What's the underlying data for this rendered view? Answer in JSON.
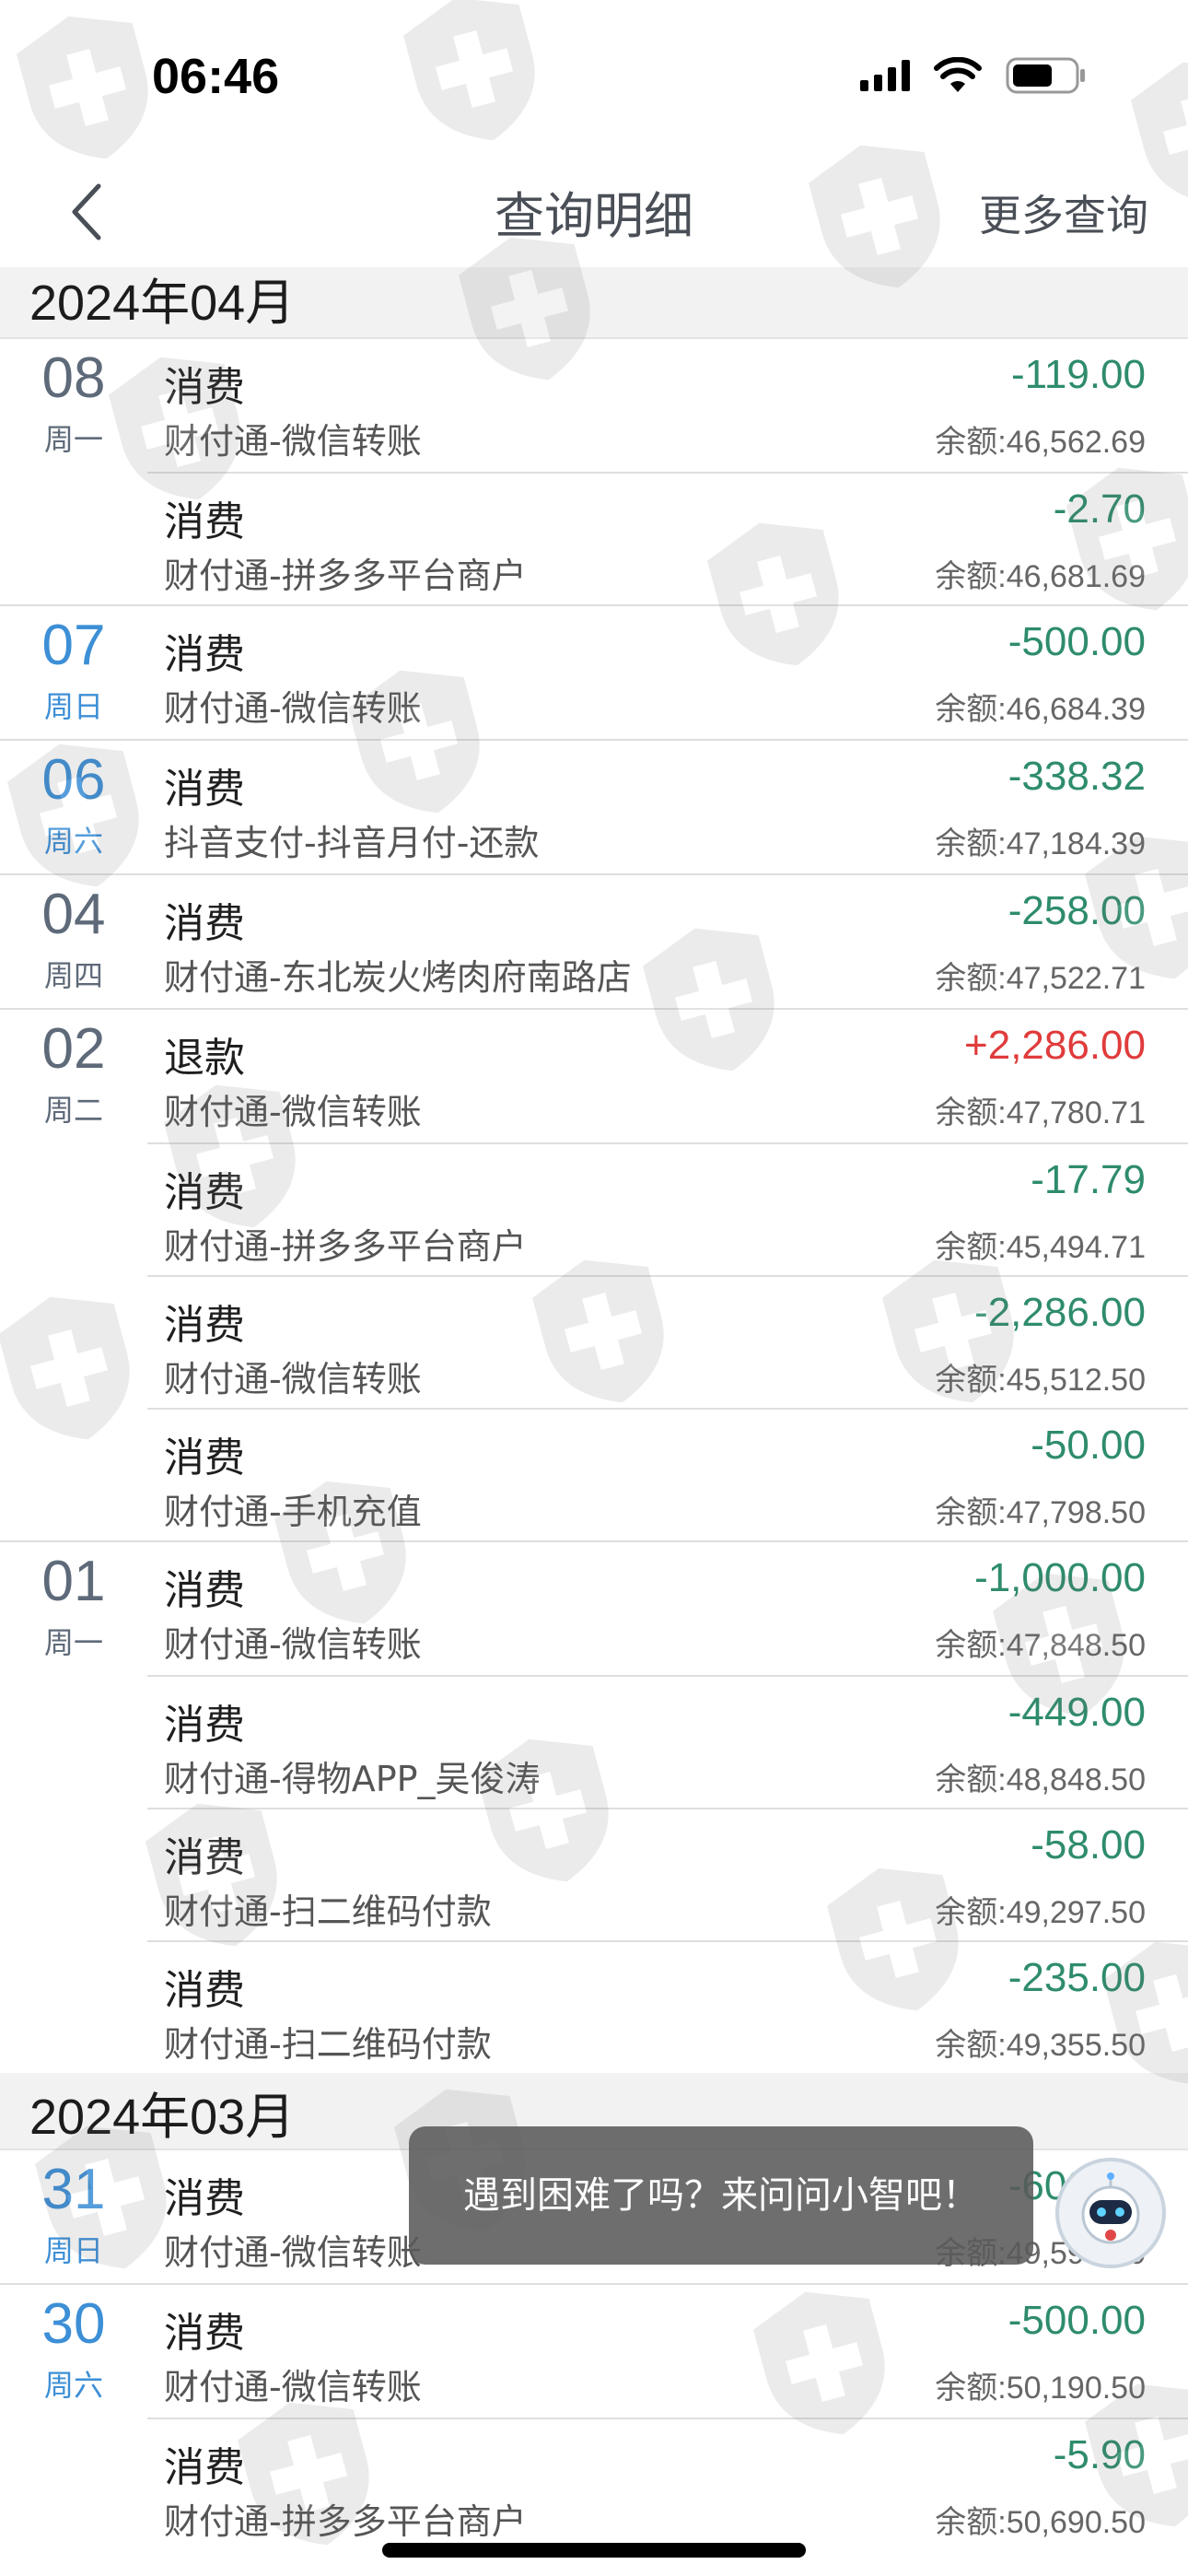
{
  "status_bar": {
    "time": "06:46"
  },
  "nav": {
    "title": "查询明细",
    "more": "更多查询"
  },
  "months": [
    {
      "label": "2024年04月",
      "days": [
        {
          "day": "08",
          "week": "周一",
          "color": "grey",
          "items": [
            {
              "type": "消费",
              "desc": "财付通-微信转账",
              "amount": "-119.00",
              "balance": "余额:46,562.69"
            },
            {
              "type": "消费",
              "desc": "财付通-拼多多平台商户",
              "amount": "-2.70",
              "balance": "余额:46,681.69"
            }
          ]
        },
        {
          "day": "07",
          "week": "周日",
          "color": "blue",
          "items": [
            {
              "type": "消费",
              "desc": "财付通-微信转账",
              "amount": "-500.00",
              "balance": "余额:46,684.39"
            }
          ]
        },
        {
          "day": "06",
          "week": "周六",
          "color": "blue",
          "items": [
            {
              "type": "消费",
              "desc": "抖音支付-抖音月付-还款",
              "amount": "-338.32",
              "balance": "余额:47,184.39"
            }
          ]
        },
        {
          "day": "04",
          "week": "周四",
          "color": "grey",
          "items": [
            {
              "type": "消费",
              "desc": "财付通-东北炭火烤肉府南路店",
              "amount": "-258.00",
              "balance": "余额:47,522.71"
            }
          ]
        },
        {
          "day": "02",
          "week": "周二",
          "color": "grey",
          "items": [
            {
              "type": "退款",
              "desc": "财付通-微信转账",
              "amount": "+2,286.00",
              "balance": "余额:47,780.71",
              "refund": true
            },
            {
              "type": "消费",
              "desc": "财付通-拼多多平台商户",
              "amount": "-17.79",
              "balance": "余额:45,494.71"
            },
            {
              "type": "消费",
              "desc": "财付通-微信转账",
              "amount": "-2,286.00",
              "balance": "余额:45,512.50"
            },
            {
              "type": "消费",
              "desc": "财付通-手机充值",
              "amount": "-50.00",
              "balance": "余额:47,798.50"
            }
          ]
        },
        {
          "day": "01",
          "week": "周一",
          "color": "grey",
          "items": [
            {
              "type": "消费",
              "desc": "财付通-微信转账",
              "amount": "-1,000.00",
              "balance": "余额:47,848.50"
            },
            {
              "type": "消费",
              "desc": "财付通-得物APP_吴俊涛",
              "amount": "-449.00",
              "balance": "余额:48,848.50"
            },
            {
              "type": "消费",
              "desc": "财付通-扫二维码付款",
              "amount": "-58.00",
              "balance": "余额:49,297.50"
            },
            {
              "type": "消费",
              "desc": "财付通-扫二维码付款",
              "amount": "-235.00",
              "balance": "余额:49,355.50"
            }
          ]
        }
      ]
    },
    {
      "label": "2024年03月",
      "days": [
        {
          "day": "31",
          "week": "周日",
          "color": "blue",
          "items": [
            {
              "type": "消费",
              "desc": "财付通-微信转账",
              "amount": "-600.00",
              "balance": "余额:49,590.50"
            }
          ]
        },
        {
          "day": "30",
          "week": "周六",
          "color": "blue",
          "items": [
            {
              "type": "消费",
              "desc": "财付通-微信转账",
              "amount": "-500.00",
              "balance": "余额:50,190.50"
            },
            {
              "type": "消费",
              "desc": "财付通-拼多多平台商户",
              "amount": "-5.90",
              "balance": "余额:50,690.50"
            }
          ]
        }
      ]
    }
  ],
  "toast": {
    "text": "遇到困难了吗？来问问小智吧！"
  },
  "icons": {
    "back": "chevron-left-icon",
    "signal": "cellular-signal-icon",
    "wifi": "wifi-icon",
    "battery": "battery-icon",
    "assistant": "robot-assistant-icon",
    "watermark": "shield-cross-icon"
  },
  "colors": {
    "debit": "#2e8c6b",
    "credit": "#e03b3b",
    "weekday_grey": "#5e6a79",
    "weekend_blue": "#3d8fd6"
  }
}
